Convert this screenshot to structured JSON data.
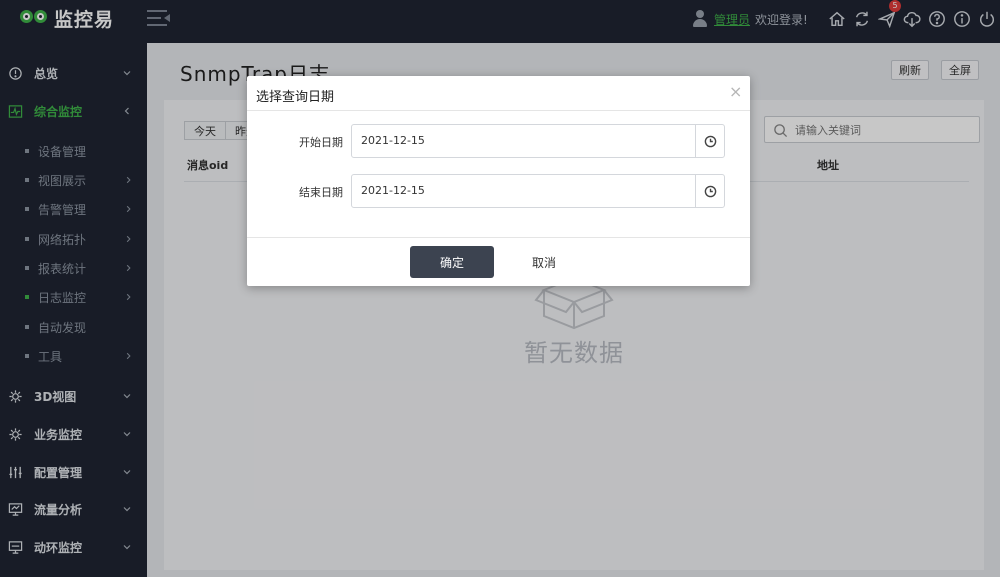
{
  "app": {
    "brand": "监控易"
  },
  "header": {
    "user_name": "管理员",
    "welcome": "欢迎登录!",
    "notification_count": "5",
    "icons": [
      "home-icon",
      "refresh-icon",
      "send-icon",
      "cloud-download-icon",
      "help-icon",
      "info-icon",
      "power-icon"
    ]
  },
  "sidebar": {
    "items": [
      {
        "label": "总览",
        "icon": "overview-icon"
      },
      {
        "label": "综合监控",
        "icon": "monitor-icon",
        "active": true
      },
      {
        "label": "3D视图",
        "icon": "3d-icon"
      },
      {
        "label": "业务监控",
        "icon": "business-icon"
      },
      {
        "label": "配置管理",
        "icon": "sliders-icon"
      },
      {
        "label": "流量分析",
        "icon": "traffic-icon"
      },
      {
        "label": "动环监控",
        "icon": "environment-icon"
      }
    ],
    "subitems": [
      {
        "label": "设备管理"
      },
      {
        "label": "视图展示"
      },
      {
        "label": "告警管理"
      },
      {
        "label": "网络拓扑"
      },
      {
        "label": "报表统计"
      },
      {
        "label": "日志监控",
        "active": true
      },
      {
        "label": "自动发现"
      },
      {
        "label": "工具"
      }
    ]
  },
  "main": {
    "title": "SnmpTrap日志",
    "refresh_label": "刷新",
    "fullscreen_label": "全屏",
    "date_tabs": [
      "今天",
      "昨天"
    ],
    "search_placeholder": "请输入关键词",
    "columns": {
      "oid": "消息oid",
      "address": "地址"
    },
    "empty_text": "暂无数据"
  },
  "dialog": {
    "title": "选择查询日期",
    "start_label": "开始日期",
    "start_value": "2021-12-15",
    "end_label": "结束日期",
    "end_value": "2021-12-15",
    "ok_label": "确定",
    "cancel_label": "取消"
  },
  "colors": {
    "accent": "#3fb24a",
    "sidebar_bg": "#1f2532",
    "primary_button": "#3c4350",
    "badge": "#e03b3b"
  }
}
